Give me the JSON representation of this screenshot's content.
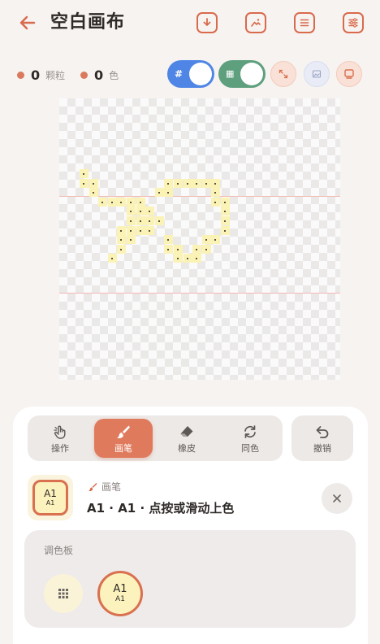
{
  "header": {
    "title": "空白画布",
    "back_icon": "arrow-left-icon",
    "actions": [
      {
        "name": "download-button",
        "icon": "download-icon"
      },
      {
        "name": "image-export-button",
        "icon": "image-icon"
      },
      {
        "name": "list-button",
        "icon": "list-icon"
      },
      {
        "name": "settings-button",
        "icon": "sliders-icon"
      }
    ]
  },
  "stats": {
    "bead_count": "0",
    "bead_unit": "颗粒",
    "color_count": "0",
    "color_unit": "色"
  },
  "toggles": {
    "grid_number": {
      "glyph": "#",
      "on": true,
      "color": "#4f86e6"
    },
    "grid_pattern": {
      "glyph": "▦",
      "on": true,
      "color": "#5e9f7e"
    }
  },
  "view_buttons": [
    {
      "name": "fit-button",
      "icon": "expand-icon"
    },
    {
      "name": "background-image-button",
      "icon": "image-icon"
    },
    {
      "name": "preview-button",
      "icon": "monitor-icon"
    }
  ],
  "tools": {
    "items": [
      {
        "name": "operate",
        "label": "操作",
        "icon": "hand-pointer-icon"
      },
      {
        "name": "brush",
        "label": "画笔",
        "icon": "brush-icon",
        "active": true
      },
      {
        "name": "eraser",
        "label": "橡皮",
        "icon": "eraser-icon"
      },
      {
        "name": "same-color",
        "label": "同色",
        "icon": "refresh-icon"
      }
    ],
    "undo_label": "撤销"
  },
  "current": {
    "code": "A1",
    "sub": "A1",
    "tool_label": "画笔",
    "description": "A1 · A1 · 点按或滑动上色"
  },
  "palette": {
    "title": "调色板",
    "swatches": [
      {
        "code": "A1",
        "sub": "A1",
        "color": "#fbf2bd",
        "selected": true
      }
    ]
  },
  "colors": {
    "accent": "#e07a5d",
    "bead": "#fbf2b6"
  }
}
